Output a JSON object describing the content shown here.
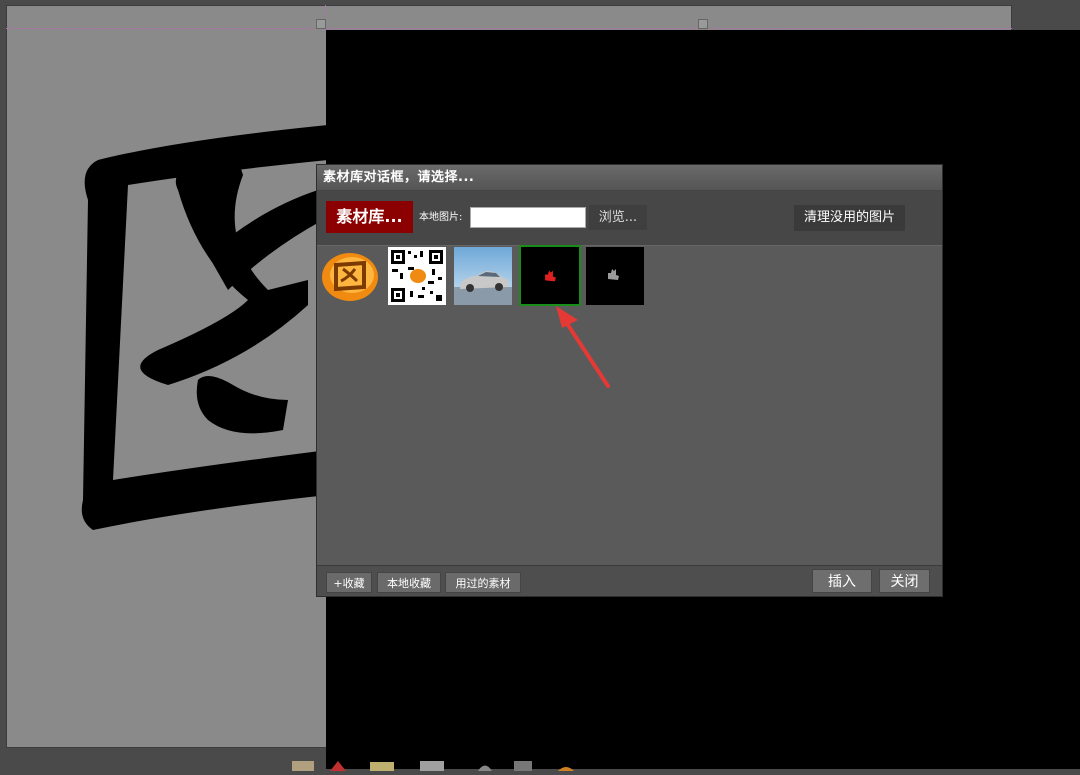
{
  "dialog": {
    "title": "素材库对话框，请选择...",
    "library_label": "素材库...",
    "local_image_label": "本地图片:",
    "local_image_value": "",
    "browse_label": "浏览...",
    "cleanup_label": "清理没用的图片"
  },
  "gallery": {
    "items": [
      {
        "icon": "tu-logo-icon",
        "selected": false
      },
      {
        "icon": "qr-code-icon",
        "selected": false
      },
      {
        "icon": "car-photo-icon",
        "selected": false
      },
      {
        "icon": "red-hand-icon",
        "selected": true
      },
      {
        "icon": "gray-hand-icon",
        "selected": false
      }
    ]
  },
  "footer": {
    "add_favorite_label": "+收藏",
    "local_favorites_label": "本地收藏",
    "used_materials_label": "用过的素材",
    "insert_label": "插入",
    "close_label": "关闭"
  },
  "colors": {
    "accent": "#8b0000",
    "selected_border": "#1a8c1a",
    "arrow": "#e53935"
  }
}
